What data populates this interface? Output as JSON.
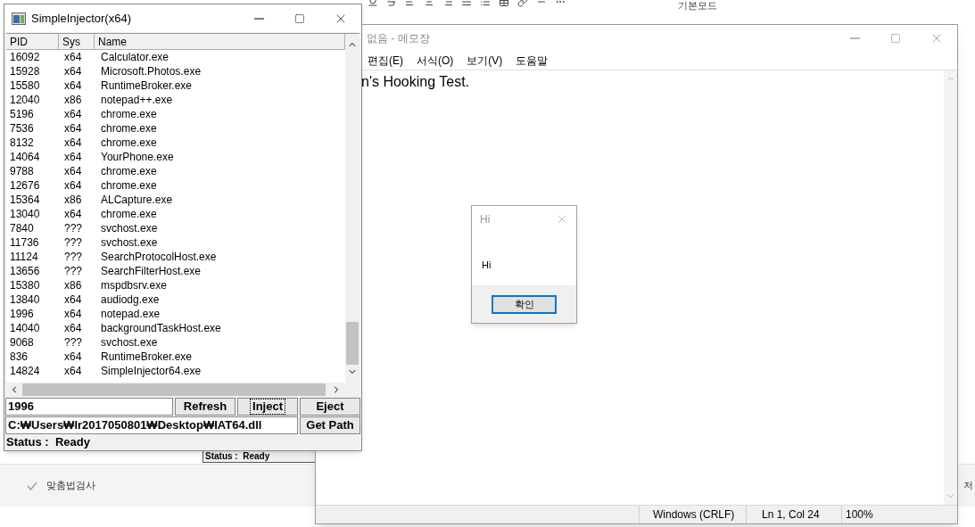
{
  "background_app": {
    "toolbar_label": "기본모드",
    "spellcheck_label": "맞춤법검사",
    "status_text": "Status :  Ready",
    "edge_text": "저"
  },
  "notepad": {
    "title": "없음 - 메모장",
    "menu": [
      "편집(E)",
      "서식(O)",
      "보기(V)",
      "도움말"
    ],
    "content": "n's Hooking Test.",
    "status": {
      "line_ending": "Windows (CRLF)",
      "position": "Ln 1, Col 24",
      "zoom": "100%"
    }
  },
  "message_box": {
    "title": "Hi",
    "message": "Hi",
    "button": "확인"
  },
  "injector": {
    "title": "SimpleInjector(x64)",
    "columns": [
      "PID",
      "Sys",
      "Name"
    ],
    "rows": [
      {
        "pid": "16092",
        "sys": "x64",
        "name": "Calculator.exe"
      },
      {
        "pid": "15928",
        "sys": "x64",
        "name": "Microsoft.Photos.exe"
      },
      {
        "pid": "15580",
        "sys": "x64",
        "name": "RuntimeBroker.exe"
      },
      {
        "pid": "12040",
        "sys": "x86",
        "name": "notepad++.exe"
      },
      {
        "pid": "5196",
        "sys": "x64",
        "name": "chrome.exe"
      },
      {
        "pid": "7536",
        "sys": "x64",
        "name": "chrome.exe"
      },
      {
        "pid": "8132",
        "sys": "x64",
        "name": "chrome.exe"
      },
      {
        "pid": "14064",
        "sys": "x64",
        "name": "YourPhone.exe"
      },
      {
        "pid": "9788",
        "sys": "x64",
        "name": "chrome.exe"
      },
      {
        "pid": "12676",
        "sys": "x64",
        "name": "chrome.exe"
      },
      {
        "pid": "15364",
        "sys": "x86",
        "name": "ALCapture.exe"
      },
      {
        "pid": "13040",
        "sys": "x64",
        "name": "chrome.exe"
      },
      {
        "pid": "7840",
        "sys": "???",
        "name": "svchost.exe"
      },
      {
        "pid": "11736",
        "sys": "???",
        "name": "svchost.exe"
      },
      {
        "pid": "11124",
        "sys": "???",
        "name": "SearchProtocolHost.exe"
      },
      {
        "pid": "13656",
        "sys": "???",
        "name": "SearchFilterHost.exe"
      },
      {
        "pid": "15380",
        "sys": "x86",
        "name": "mspdbsrv.exe"
      },
      {
        "pid": "13840",
        "sys": "x64",
        "name": "audiodg.exe"
      },
      {
        "pid": "1996",
        "sys": "x64",
        "name": "notepad.exe"
      },
      {
        "pid": "14040",
        "sys": "x64",
        "name": "backgroundTaskHost.exe"
      },
      {
        "pid": "9068",
        "sys": "???",
        "name": "svchost.exe"
      },
      {
        "pid": "836",
        "sys": "x64",
        "name": "RuntimeBroker.exe"
      },
      {
        "pid": "14824",
        "sys": "x64",
        "name": "SimpleInjector64.exe"
      }
    ],
    "pid_field": "1996",
    "buttons": [
      {
        "label": "Refresh",
        "focused": false
      },
      {
        "label": "Inject",
        "focused": true
      },
      {
        "label": "Eject",
        "focused": false
      }
    ],
    "path_field": "C:₩Users₩lr2017050801₩Desktop₩IAT64.dll",
    "path_button": "Get Path",
    "status": "Status :  Ready"
  }
}
